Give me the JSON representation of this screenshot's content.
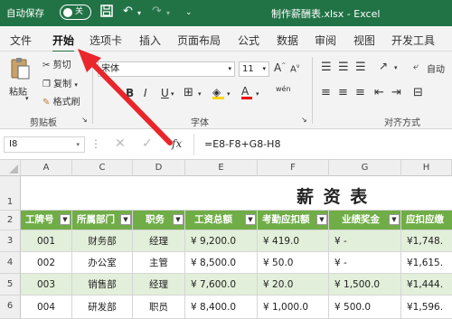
{
  "titlebar": {
    "autosave_label": "自动保存",
    "toggle_state": "关",
    "document_title": "制作薪酬表.xlsx  -  Excel"
  },
  "tabs": [
    "文件",
    "开始",
    "选项卡",
    "插入",
    "页面布局",
    "公式",
    "数据",
    "审阅",
    "视图",
    "开发工具"
  ],
  "ribbon": {
    "paste": "粘贴",
    "cut": "剪切",
    "copy": "复制",
    "format_painter": "格式刷",
    "font_name": "宋体",
    "font_size": "11",
    "bold": "B",
    "italic": "I",
    "underline": "U",
    "font_color": "A",
    "font_grow": "A",
    "font_shrink": "A",
    "wen": "wén",
    "clipboard_label": "剪贴板",
    "font_label": "字体",
    "align_label": "对齐方式",
    "wrap_partial": "自动"
  },
  "formula_bar": {
    "name_box": "I8",
    "fx": "fx",
    "formula": "=E8-F8+G8-H8"
  },
  "sheet": {
    "columns": [
      "A",
      "C",
      "D",
      "E",
      "F",
      "G",
      "H"
    ],
    "row_numbers": [
      "1",
      "2",
      "3",
      "4",
      "5",
      "6"
    ],
    "title": "薪  资  表",
    "headers": [
      "工牌号",
      "所属部门",
      "职务",
      "工资总额",
      "考勤应扣额",
      "业绩奖金",
      "应扣应缴"
    ],
    "rows": [
      [
        "001",
        "财务部",
        "经理",
        "¥   9,200.0",
        "¥       419.0",
        "¥         -",
        "¥1,748."
      ],
      [
        "002",
        "办公室",
        "主管",
        "¥   8,500.0",
        "¥         50.0",
        "¥         -",
        "¥1,615."
      ],
      [
        "003",
        "销售部",
        "经理",
        "¥   7,600.0",
        "¥         20.0",
        "¥   1,500.0",
        "¥1,444."
      ],
      [
        "004",
        "研发部",
        "职员",
        "¥   8,400.0",
        "¥   1,000.0",
        "¥       500.0",
        "¥1,596."
      ]
    ]
  },
  "colors": {
    "excel_green": "#217346",
    "header_fill": "#70ad47",
    "band_fill": "#e2efda",
    "arrow_red": "#e8262b"
  }
}
